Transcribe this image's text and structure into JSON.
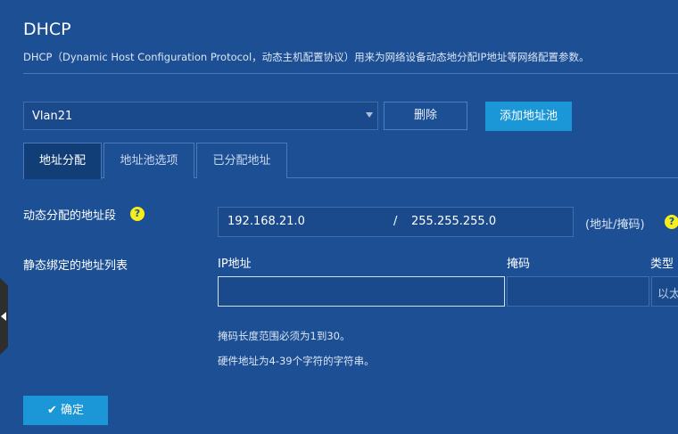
{
  "header": {
    "title": "DHCP",
    "description": "DHCP（Dynamic Host Configuration Protocol，动态主机配置协议）用来为网络设备动态地分配IP地址等网络配置参数。"
  },
  "pool": {
    "selected": "Vlan21",
    "delete_label": "删除",
    "add_label": "添加地址池"
  },
  "tabs": [
    {
      "label": "地址分配",
      "active": true
    },
    {
      "label": "地址池选项",
      "active": false
    },
    {
      "label": "已分配地址",
      "active": false
    }
  ],
  "dynamic_range": {
    "label": "动态分配的地址段",
    "ip": "192.168.21.0",
    "separator": "/",
    "mask": "255.255.255.0",
    "unit": "(地址/掩码)"
  },
  "static_binding": {
    "label": "静态绑定的地址列表",
    "columns": [
      "IP地址",
      "掩码",
      "类型"
    ],
    "ip_value": "",
    "mask_value": "",
    "type_value": "以太"
  },
  "hints": [
    "掩码长度范围必须为1到30。",
    "硬件地址为4-39个字符的字符串。"
  ],
  "confirm_label": "确定",
  "help_glyph": "?",
  "colors": {
    "background": "#1c4f94",
    "accent": "#1b97d8",
    "help": "#f4ee1f"
  }
}
